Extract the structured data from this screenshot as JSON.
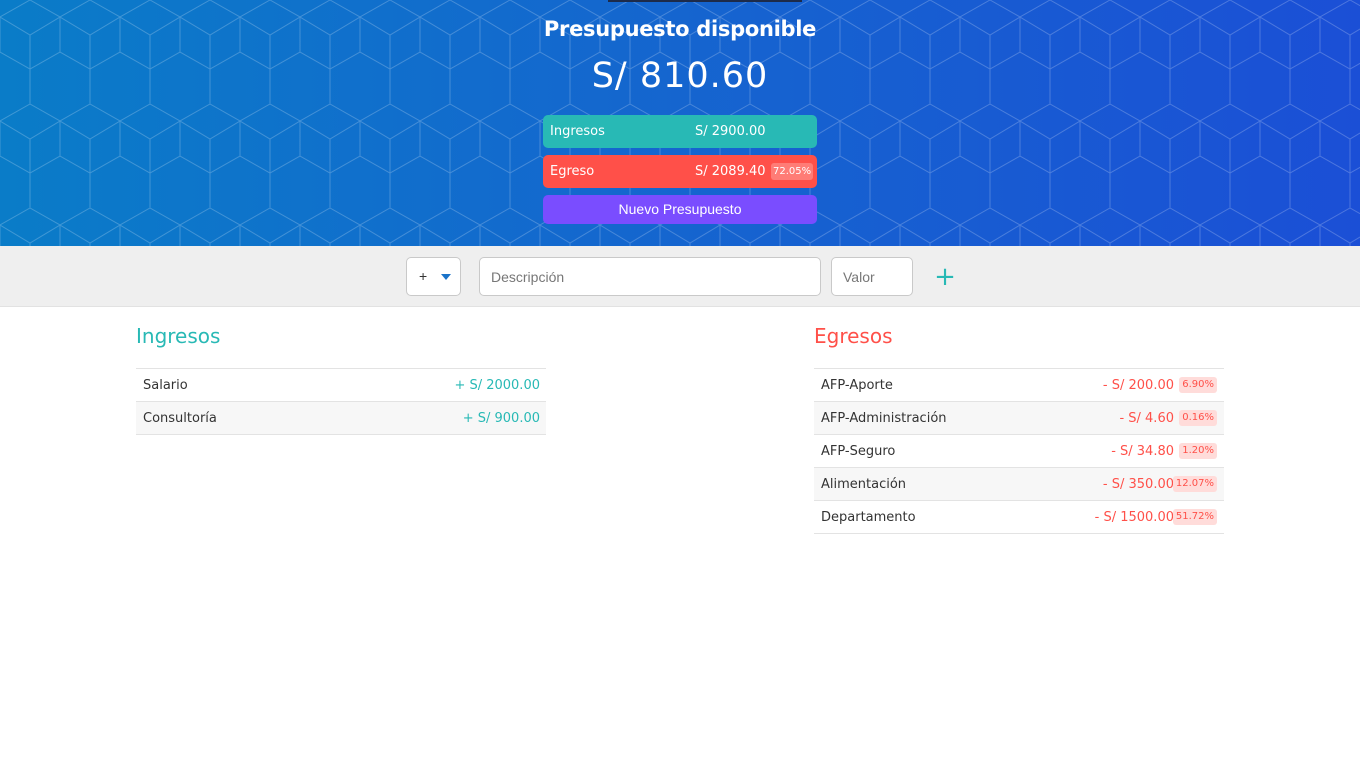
{
  "header": {
    "title": "Presupuesto disponible",
    "total": "S/ 810.60",
    "income_label": "Ingresos",
    "income_value": "S/ 2900.00",
    "expense_label": "Egreso",
    "expense_value": "S/ 2089.40",
    "expense_percentage": "72.05%",
    "new_budget_label": "Nuevo Presupuesto"
  },
  "add_form": {
    "type_value": "+",
    "description_placeholder": "Descripción",
    "value_placeholder": "Valor",
    "add_icon": "plus-icon"
  },
  "income": {
    "title": "Ingresos",
    "items": [
      {
        "description": "Salario",
        "value": "+ S/ 2000.00"
      },
      {
        "description": "Consultoría",
        "value": "+ S/ 900.00"
      }
    ]
  },
  "expenses": {
    "title": "Egresos",
    "items": [
      {
        "description": "AFP-Aporte",
        "value": "- S/ 200.00",
        "percentage": "6.90%"
      },
      {
        "description": "AFP-Administración",
        "value": "- S/ 4.60",
        "percentage": "0.16%"
      },
      {
        "description": "AFP-Seguro",
        "value": "- S/ 34.80",
        "percentage": "1.20%"
      },
      {
        "description": "Alimentación",
        "value": "- S/ 350.00",
        "percentage": "12.07%"
      },
      {
        "description": "Departamento",
        "value": "- S/ 1500.00",
        "percentage": "51.72%"
      }
    ]
  },
  "colors": {
    "income": "#28b9b5",
    "expense": "#ff5049",
    "button": "#7a4dff",
    "header_start": "#0a7cc8",
    "header_end": "#1b4fd6"
  }
}
